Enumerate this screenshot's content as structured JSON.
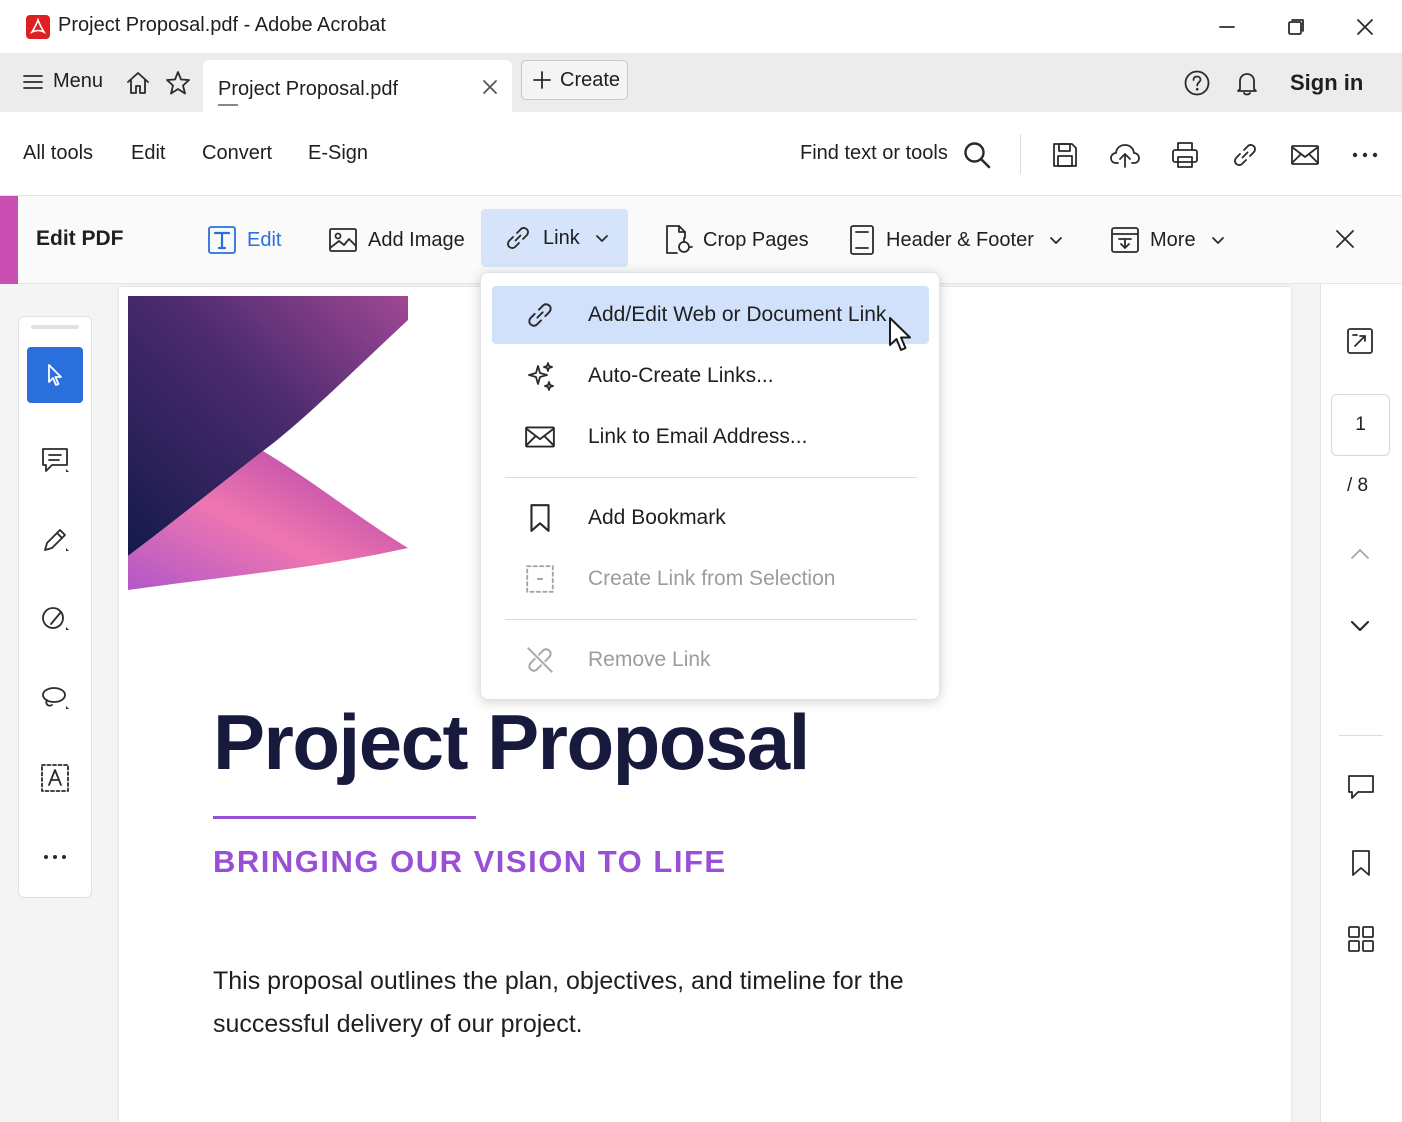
{
  "window": {
    "title": "Project Proposal.pdf - Adobe Acrobat",
    "app_icon": "acrobat-icon",
    "controls": [
      "minimize-icon",
      "restore-icon",
      "close-icon"
    ]
  },
  "tabbar": {
    "menu_label": "Menu",
    "doc_tab_label": "Project Proposal.pdf",
    "create_label": "Create",
    "sign_in_label": "Sign in",
    "icons": [
      "home-icon",
      "star-icon",
      "help-icon",
      "bell-icon"
    ]
  },
  "toolbar": {
    "items": [
      "All tools",
      "Edit",
      "Convert",
      "E-Sign"
    ],
    "find_label": "Find text or tools",
    "icons": [
      "search-icon",
      "save-icon",
      "upload-cloud-icon",
      "print-icon",
      "link-icon",
      "email-icon",
      "more-icon"
    ]
  },
  "editbar": {
    "title": "Edit PDF",
    "edit_label": "Edit",
    "add_image_label": "Add Image",
    "link_label": "Link",
    "crop_label": "Crop Pages",
    "header_footer_label": "Header & Footer",
    "more_label": "More"
  },
  "dropdown": {
    "items": [
      {
        "label": "Add/Edit Web or Document Link",
        "icon": "link-icon",
        "highlighted": true
      },
      {
        "label": "Auto-Create Links...",
        "icon": "sparkle-icon"
      },
      {
        "label": "Link to Email Address...",
        "icon": "email-icon"
      },
      {
        "label": "Add Bookmark",
        "icon": "bookmark-icon"
      },
      {
        "label": "Create Link from Selection",
        "icon": "selection-icon",
        "disabled": true
      },
      {
        "label": "Remove Link",
        "icon": "unlink-icon",
        "disabled": true
      }
    ]
  },
  "page_nav": {
    "current_page": "1",
    "total_pages": "/ 8"
  },
  "document": {
    "title": "Project Proposal",
    "subtitle": "BRINGING OUR VISION TO LIFE",
    "body": "This proposal outlines the plan, objectives, and timeline for the successful delivery of our project.",
    "body_line1": "This proposal outlines the plan, objectives, and timeline for the",
    "body_line2": "successful delivery of our project."
  },
  "colors": {
    "accent_blue": "#2a6fdb",
    "highlight_blue": "#d2e1fb",
    "edit_accent": "#c94fb2",
    "title_navy": "#171a3c",
    "subtitle_purple": "#9a50d6"
  }
}
